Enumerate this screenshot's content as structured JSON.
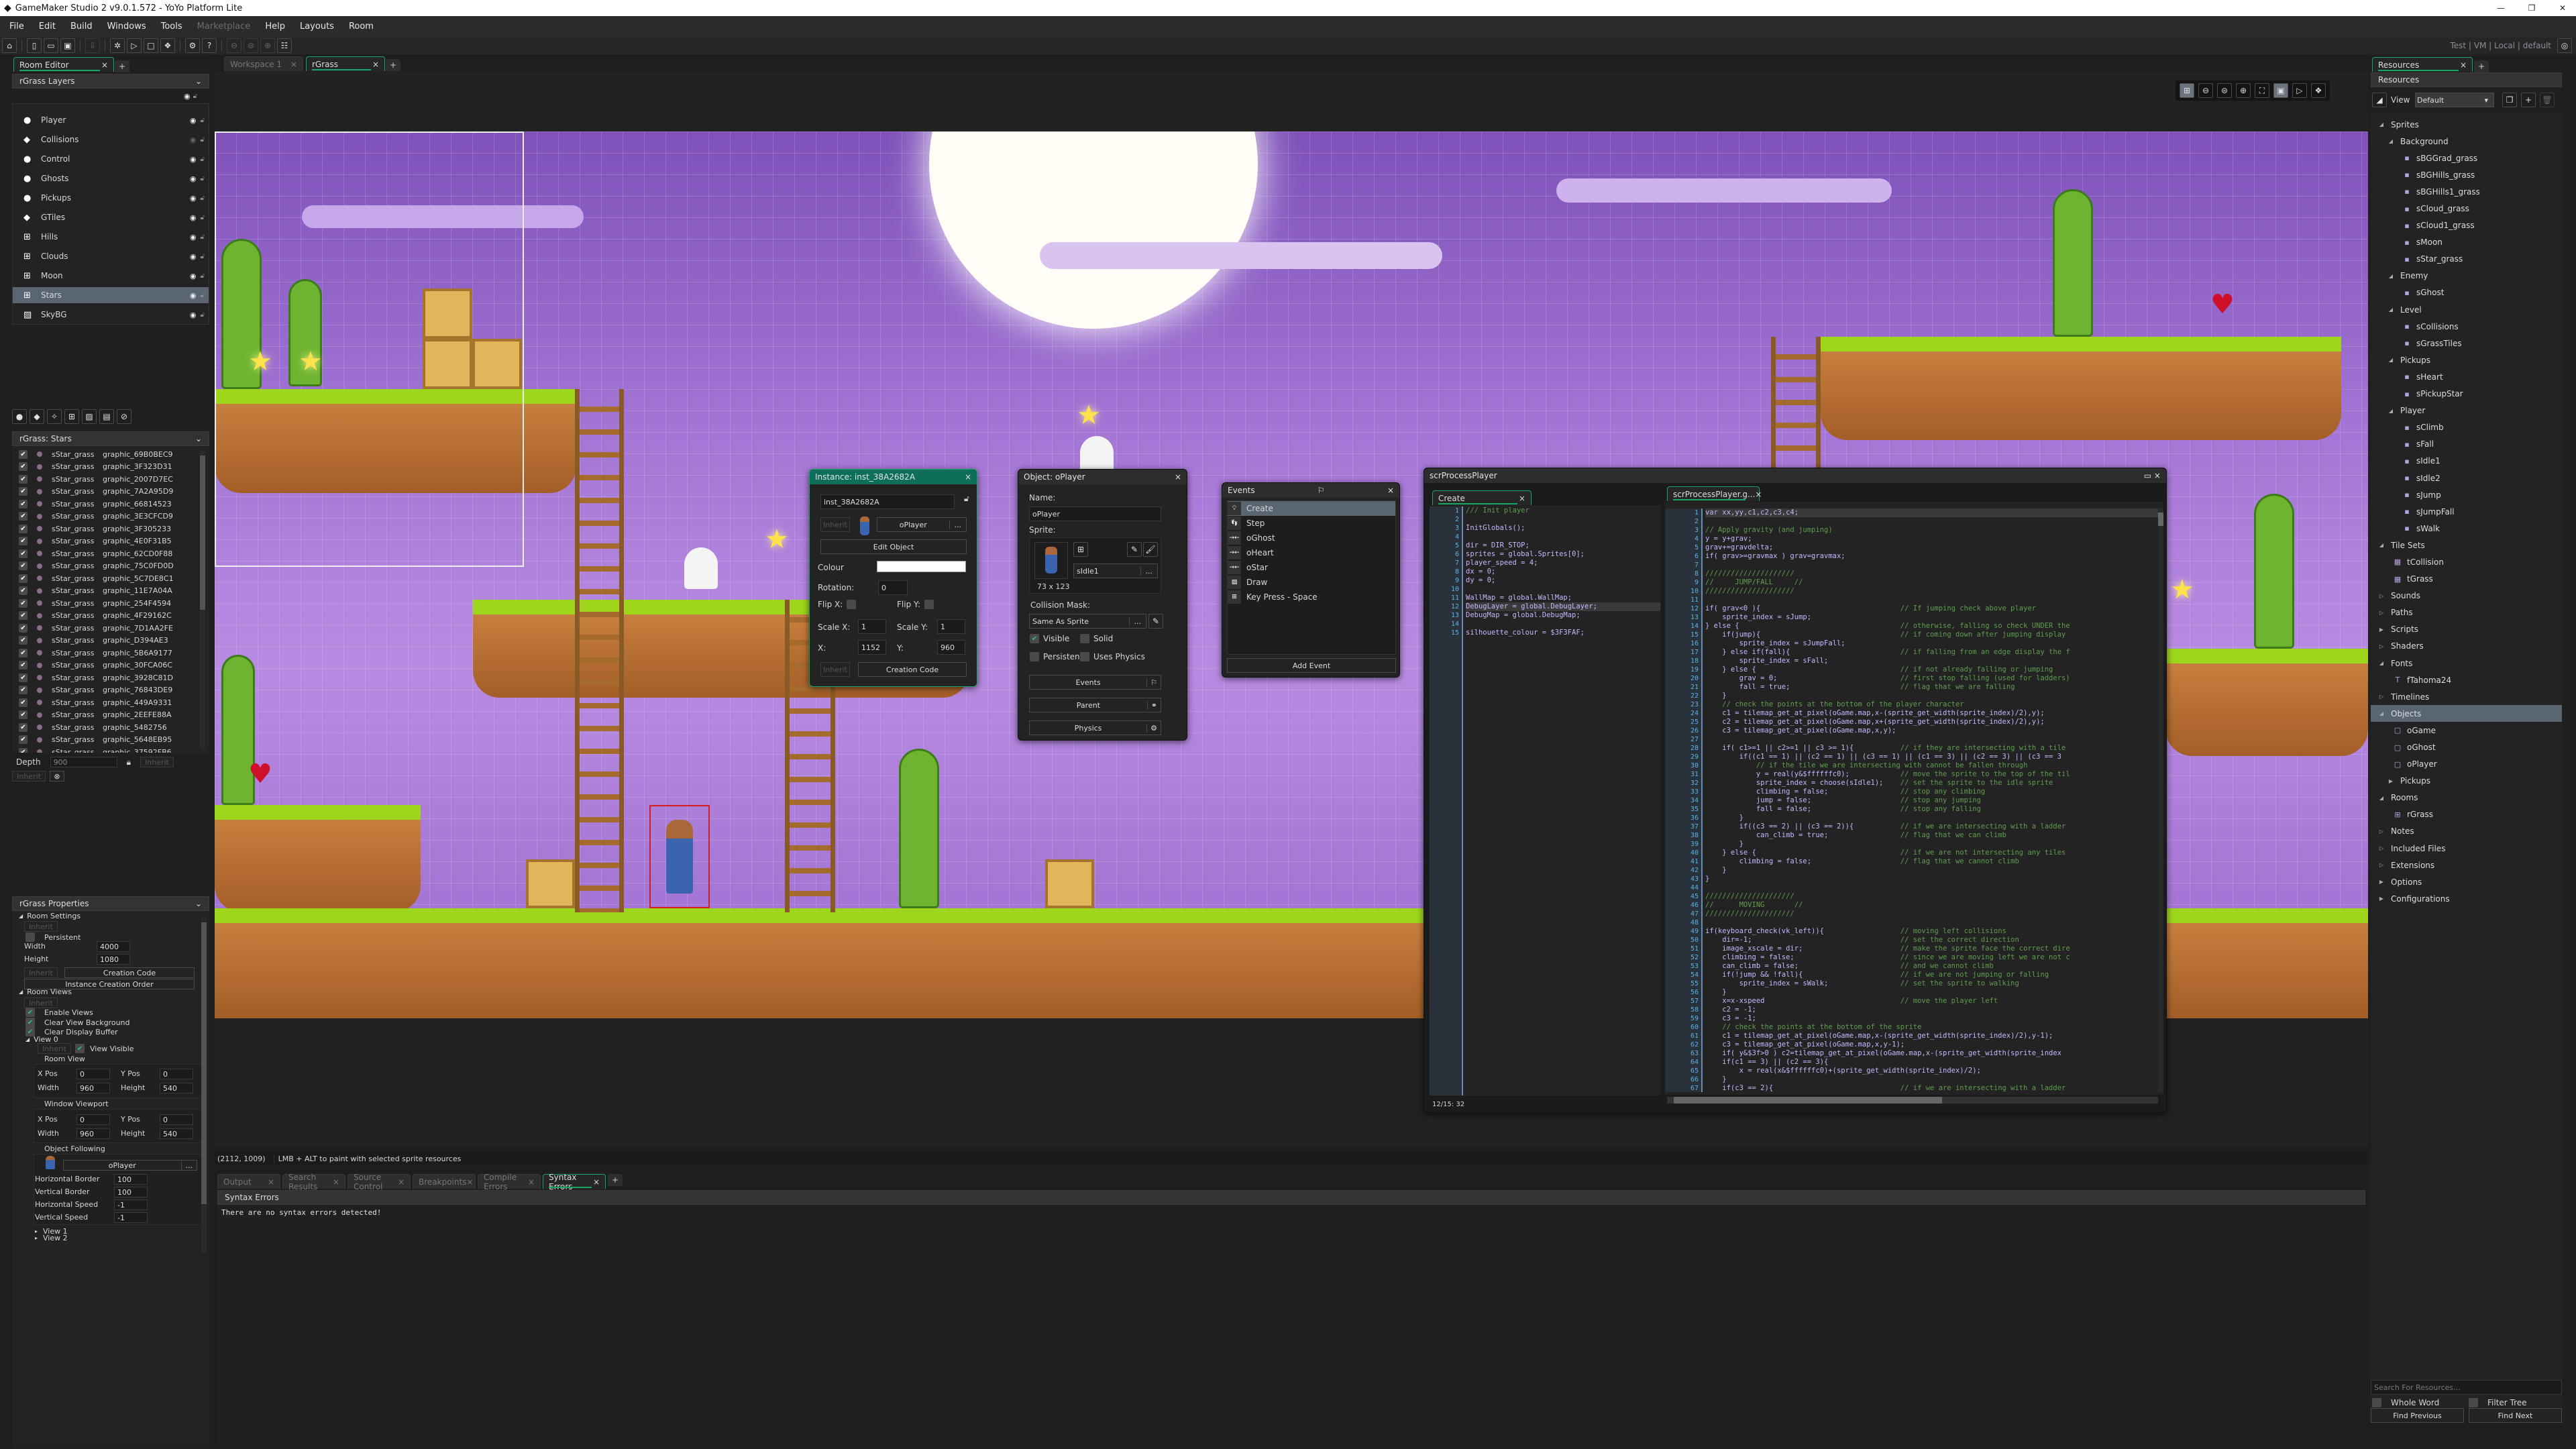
{
  "app": {
    "title": "GameMaker Studio 2   v9.0.1.572 - YoYo Platform Lite",
    "logo": "gamemaker-logo"
  },
  "menu": [
    "File",
    "Edit",
    "Build",
    "Windows",
    "Tools",
    "Marketplace",
    "Help",
    "Layouts",
    "Room"
  ],
  "menu_disabled": [
    "Marketplace"
  ],
  "target": {
    "label": "Test | VM | Local | default"
  },
  "left": {
    "tab": "Room Editor",
    "layers_header": "rGrass Layers",
    "layers": [
      {
        "name": "Player",
        "type": "instance",
        "visible": true
      },
      {
        "name": "Collisions",
        "type": "tile",
        "visible": false
      },
      {
        "name": "Control",
        "type": "instance",
        "visible": true
      },
      {
        "name": "Ghosts",
        "type": "instance",
        "visible": true
      },
      {
        "name": "Pickups",
        "type": "instance",
        "visible": true
      },
      {
        "name": "GTiles",
        "type": "tile",
        "visible": true
      },
      {
        "name": "Hills",
        "type": "asset",
        "visible": true
      },
      {
        "name": "Clouds",
        "type": "asset",
        "visible": true
      },
      {
        "name": "Moon",
        "type": "asset",
        "visible": true
      },
      {
        "name": "Stars",
        "type": "asset",
        "visible": true,
        "selected": true
      },
      {
        "name": "SkyBG",
        "type": "background",
        "visible": true
      }
    ],
    "assets_header": "rGrass: Stars",
    "assets": [
      [
        "sStar_grass",
        "graphic_69B0BEC9"
      ],
      [
        "sStar_grass",
        "graphic_3F323D31"
      ],
      [
        "sStar_grass",
        "graphic_2007D7EC"
      ],
      [
        "sStar_grass",
        "graphic_7A2A95D9"
      ],
      [
        "sStar_grass",
        "graphic_66814523"
      ],
      [
        "sStar_grass",
        "graphic_3E3CFCD9"
      ],
      [
        "sStar_grass",
        "graphic_3F305233"
      ],
      [
        "sStar_grass",
        "graphic_4E0F31B5"
      ],
      [
        "sStar_grass",
        "graphic_62CD0F88"
      ],
      [
        "sStar_grass",
        "graphic_75C0FD0D"
      ],
      [
        "sStar_grass",
        "graphic_5C7DE8C1"
      ],
      [
        "sStar_grass",
        "graphic_11E7A04A"
      ],
      [
        "sStar_grass",
        "graphic_254F4594"
      ],
      [
        "sStar_grass",
        "graphic_4F29162C"
      ],
      [
        "sStar_grass",
        "graphic_7D1AA2FE"
      ],
      [
        "sStar_grass",
        "graphic_D394AE3"
      ],
      [
        "sStar_grass",
        "graphic_5B6A9177"
      ],
      [
        "sStar_grass",
        "graphic_30FCA06C"
      ],
      [
        "sStar_grass",
        "graphic_3928C81D"
      ],
      [
        "sStar_grass",
        "graphic_76843DE9"
      ],
      [
        "sStar_grass",
        "graphic_449A9331"
      ],
      [
        "sStar_grass",
        "graphic_2EEFE88A"
      ],
      [
        "sStar_grass",
        "graphic_5482756"
      ],
      [
        "sStar_grass",
        "graphic_5648EB95"
      ],
      [
        "sStar_grass",
        "graphic_37592FB6"
      ]
    ],
    "depth_label": "Depth",
    "depth_value": "900",
    "inherit": "Inherit",
    "props": {
      "header": "rGrass Properties",
      "room_settings": "Room Settings",
      "persistent": "Persistent",
      "width_label": "Width",
      "width": "4000",
      "height_label": "Height",
      "height": "1080",
      "creation_code": "Creation Code",
      "instance_order": "Instance Creation Order",
      "room_views": "Room Views",
      "enable_views": "Enable Views",
      "clear_view_bg": "Clear View Background",
      "clear_display": "Clear Display Buffer",
      "view0": "View 0",
      "view_visible": "View Visible",
      "room_view": "Room View",
      "window_viewport": "Window Viewport",
      "xpos": "X Pos",
      "ypos": "Y Pos",
      "w": "Width",
      "h": "Height",
      "rv": {
        "x": "0",
        "y": "0",
        "w": "960",
        "h": "540"
      },
      "wv": {
        "x": "0",
        "y": "0",
        "w": "960",
        "h": "540"
      },
      "object_following": "Object Following",
      "follow_obj": "oPlayer",
      "dots": "...",
      "hborder_label": "Horizontal Border",
      "hborder": "100",
      "vborder_label": "Vertical Border",
      "vborder": "100",
      "hspeed_label": "Horizontal Speed",
      "hspeed": "-1",
      "vspeed_label": "Vertical Speed",
      "vspeed": "-1",
      "view1": "View 1",
      "view2": "View 2"
    }
  },
  "workspace": {
    "tabs": [
      "Workspace 1",
      "rGrass"
    ],
    "active": "rGrass"
  },
  "status": {
    "coords": "(2112, 1009)",
    "hint": "LMB + ALT to paint with selected sprite resources"
  },
  "output": {
    "tabs": [
      "Output",
      "Search Results",
      "Source Control",
      "Breakpoints",
      "Compile Errors",
      "Syntax Errors"
    ],
    "active": "Syntax Errors",
    "header": "Syntax Errors",
    "message": "There are no syntax errors detected!"
  },
  "instance": {
    "title": "Instance: inst_38A2682A",
    "name": "inst_38A2682A",
    "inherit": "Inherit",
    "object": "oPlayer",
    "dots": "...",
    "edit": "Edit Object",
    "colour_label": "Colour",
    "colour": "#ffffff",
    "rotation_label": "Rotation:",
    "rotation": "0",
    "flipx": "Flip X:",
    "flipy": "Flip Y:",
    "scalex_label": "Scale X:",
    "scalex": "1",
    "scaley_label": "Scale Y:",
    "scaley": "1",
    "x_label": "X:",
    "x": "1152",
    "y_label": "Y:",
    "y": "960",
    "creation_code": "Creation Code"
  },
  "object": {
    "title": "Object: oPlayer",
    "name_label": "Name:",
    "name": "oPlayer",
    "sprite_label": "Sprite:",
    "sprite": "sIdle1",
    "dots": "...",
    "size": "73 x 123",
    "mask_label": "Collision Mask:",
    "mask": "Same As Sprite",
    "visible": "Visible",
    "solid": "Solid",
    "persistent": "Persistent",
    "physics_flag": "Uses Physics",
    "events": "Events",
    "parent": "Parent",
    "physics": "Physics"
  },
  "events": {
    "title": "Events",
    "items": [
      {
        "label": "Create",
        "icon": "lightbulb-icon",
        "selected": true
      },
      {
        "label": "Step",
        "icon": "footsteps-icon"
      },
      {
        "label": "oGhost",
        "icon": "collision-icon"
      },
      {
        "label": "oHeart",
        "icon": "collision-icon"
      },
      {
        "label": "oStar",
        "icon": "collision-icon"
      },
      {
        "label": "Draw",
        "icon": "draw-icon"
      },
      {
        "label": "Key Press - Space",
        "icon": "keypress-icon"
      }
    ],
    "add": "Add Event"
  },
  "code": {
    "title": "scrProcessPlayer",
    "create_tab": "Create",
    "script_tab": "scrProcessPlayer.g...",
    "cursor": "12/15: 32",
    "create_lines": [
      "/// Init player",
      "",
      "InitGlobals();",
      "",
      "dir = DIR_STOP;",
      "sprites = global.Sprites[0];",
      "player_speed = 4;",
      "dx = 0;",
      "dy = 0;",
      "",
      "WallMap = global.WallMap;",
      "DebugLayer = global.DebugLayer;",
      "DebugMap = global.DebugMap;",
      "",
      "silhouette_colour = $3F3FAF;"
    ],
    "script_lines": [
      "var xx,yy,c1,c2,c3,c4;",
      "",
      "// Apply gravity (and jumping)",
      "y = y+grav;",
      "grav+=gravdelta;",
      "if( grav>=gravmax ) grav=gravmax;",
      "",
      "/////////////////////",
      "//     JUMP/FALL     //",
      "/////////////////////",
      "",
      "if( grav<0 ){                                 // If jumping check above player",
      "    sprite_index = sJump;",
      "} else {                                      // otherwise, falling so check UNDER the",
      "    if(jump){                                 // if coming down after jumping display",
      "        sprite_index = sJumpFall;",
      "    } else if(fall){                          // if falling from an edge display the f",
      "        sprite_index = sFall;",
      "    } else {                                  // if not already falling or jumping",
      "        grav = 0;                             // first stop falling (used for ladders)",
      "        fall = true;                          // flag that we are falling",
      "    }",
      "    // check the points at the bottom of the player character",
      "    c1 = tilemap_get_at_pixel(oGame.map,x-(sprite_get_width(sprite_index)/2),y);",
      "    c2 = tilemap_get_at_pixel(oGame.map,x+(sprite_get_width(sprite_index)/2),y);",
      "    c3 = tilemap_get_at_pixel(oGame.map,x,y);",
      "",
      "    if( c1>=1 || c2>=1 || c3 >= 1){           // if they are intersecting with a tile",
      "        if((c1 == 1) || (c2 == 1) || (c3 == 1) || (c1 == 3) || (c2 == 3) || (c3 == 3",
      "            // if the tile we are intersecting with cannot be fallen through",
      "            y = real(y&$ffffffc0);            // move the sprite to the top of the til",
      "            sprite_index = choose(sIdle1);    // set the sprite to the idle sprite",
      "            climbing = false;                 // stop any climbing",
      "            jump = false;                     // stop any jumping",
      "            fall = false;                     // stop any falling",
      "        }",
      "        if((c3 == 2) || (c3 == 2)){           // if we are intersecting with a ladder",
      "            can_climb = true;                 // flag that we can climb",
      "        }",
      "    } else {                                  // if we are not intersecting any tiles",
      "        climbing = false;                     // flag that we cannot climb",
      "    }",
      "}",
      "",
      "/////////////////////",
      "//      MOVING       //",
      "/////////////////////",
      "",
      "if(keyboard_check(vk_left)){                  // moving left collisions",
      "    dir=-1;                                   // set the correct direction",
      "    image_xscale = dir;                       // make the sprite face the correct dire",
      "    climbing = false;                         // since we are moving left we are not c",
      "    can_climb = false;                        // and we cannot climb",
      "    if(!jump && !fall){                       // if we are not jumping or falling",
      "        sprite_index = sWalk;                 // set the sprite to walking",
      "    }",
      "    x=x-xspeed                                // move the player left",
      "    c2 = -1;",
      "    c3 = -1;",
      "    // check the points at the bottom of the sprite",
      "    c1 = tilemap_get_at_pixel(oGame.map,x-(sprite_get_width(sprite_index)/2),y-1);",
      "    c3 = tilemap_get_at_pixel(oGame.map,x,y-1);",
      "    if( y&$3f>0 ) c2=tilemap_get_at_pixel(oGame.map,x-(sprite_get_width(sprite_index",
      "    if(c1 == 3) || (c2 == 3){",
      "        x = real(x&$ffffffc0)+(sprite_get_width(sprite_index)/2);",
      "    }",
      "    if(c3 == 2){                              // if we are intersecting with a ladder"
    ]
  },
  "resources": {
    "tab": "Resources",
    "header": "Resources",
    "view_label": "View",
    "view": "Default",
    "tree": [
      {
        "l": 0,
        "t": "Sprites",
        "k": "open"
      },
      {
        "l": 1,
        "t": "Background",
        "k": "open"
      },
      {
        "l": 2,
        "t": "sBGGrad_grass",
        "k": "sprite"
      },
      {
        "l": 2,
        "t": "sBGHills_grass",
        "k": "sprite"
      },
      {
        "l": 2,
        "t": "sBGHills1_grass",
        "k": "sprite"
      },
      {
        "l": 2,
        "t": "sCloud_grass",
        "k": "sprite"
      },
      {
        "l": 2,
        "t": "sCloud1_grass",
        "k": "sprite"
      },
      {
        "l": 2,
        "t": "sMoon",
        "k": "sprite"
      },
      {
        "l": 2,
        "t": "sStar_grass",
        "k": "sprite"
      },
      {
        "l": 1,
        "t": "Enemy",
        "k": "open"
      },
      {
        "l": 2,
        "t": "sGhost",
        "k": "sprite"
      },
      {
        "l": 1,
        "t": "Level",
        "k": "open"
      },
      {
        "l": 2,
        "t": "sCollisions",
        "k": "sprite"
      },
      {
        "l": 2,
        "t": "sGrassTiles",
        "k": "sprite"
      },
      {
        "l": 1,
        "t": "Pickups",
        "k": "open"
      },
      {
        "l": 2,
        "t": "sHeart",
        "k": "sprite"
      },
      {
        "l": 2,
        "t": "sPickupStar",
        "k": "sprite"
      },
      {
        "l": 1,
        "t": "Player",
        "k": "open"
      },
      {
        "l": 2,
        "t": "sClimb",
        "k": "sprite"
      },
      {
        "l": 2,
        "t": "sFall",
        "k": "sprite"
      },
      {
        "l": 2,
        "t": "sIdle1",
        "k": "sprite"
      },
      {
        "l": 2,
        "t": "sIdle2",
        "k": "sprite"
      },
      {
        "l": 2,
        "t": "sJump",
        "k": "sprite"
      },
      {
        "l": 2,
        "t": "sJumpFall",
        "k": "sprite"
      },
      {
        "l": 2,
        "t": "sWalk",
        "k": "sprite"
      },
      {
        "l": 0,
        "t": "Tile Sets",
        "k": "open"
      },
      {
        "l": 1,
        "t": "tCollision",
        "k": "tileset"
      },
      {
        "l": 1,
        "t": "tGrass",
        "k": "tileset"
      },
      {
        "l": 0,
        "t": "Sounds",
        "k": "empty"
      },
      {
        "l": 0,
        "t": "Paths",
        "k": "empty"
      },
      {
        "l": 0,
        "t": "Scripts",
        "k": "closed"
      },
      {
        "l": 0,
        "t": "Shaders",
        "k": "empty"
      },
      {
        "l": 0,
        "t": "Fonts",
        "k": "open"
      },
      {
        "l": 1,
        "t": "fTahoma24",
        "k": "font"
      },
      {
        "l": 0,
        "t": "Timelines",
        "k": "empty"
      },
      {
        "l": 0,
        "t": "Objects",
        "k": "open",
        "selected": true
      },
      {
        "l": 1,
        "t": "oGame",
        "k": "object"
      },
      {
        "l": 1,
        "t": "oGhost",
        "k": "object"
      },
      {
        "l": 1,
        "t": "oPlayer",
        "k": "object"
      },
      {
        "l": 1,
        "t": "Pickups",
        "k": "closed"
      },
      {
        "l": 0,
        "t": "Rooms",
        "k": "open"
      },
      {
        "l": 1,
        "t": "rGrass",
        "k": "room"
      },
      {
        "l": 0,
        "t": "Notes",
        "k": "empty"
      },
      {
        "l": 0,
        "t": "Included Files",
        "k": "empty"
      },
      {
        "l": 0,
        "t": "Extensions",
        "k": "empty"
      },
      {
        "l": 0,
        "t": "Options",
        "k": "closed"
      },
      {
        "l": 0,
        "t": "Configurations",
        "k": "closed"
      }
    ],
    "search_placeholder": "Search For Resources...",
    "whole_word": "Whole Word",
    "filter_tree": "Filter Tree",
    "find_prev": "Find Previous",
    "find_next": "Find Next"
  },
  "colors": {
    "accent": "#17a665",
    "selection": "#5a6572"
  }
}
